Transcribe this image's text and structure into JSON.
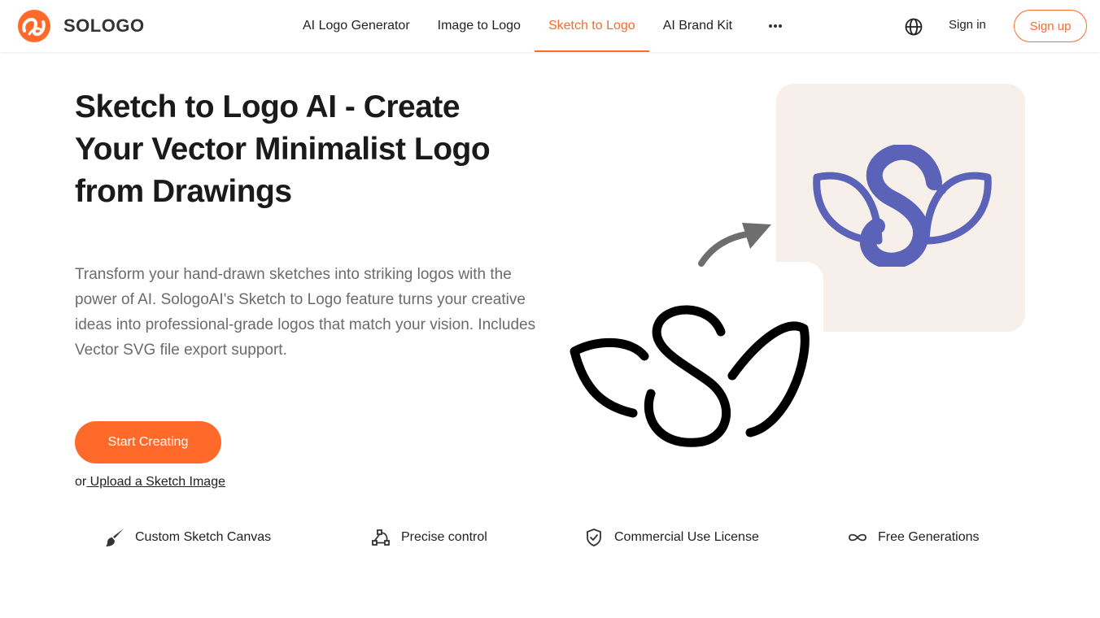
{
  "header": {
    "brand": "SOLOGO",
    "nav": [
      {
        "label": "AI Logo Generator",
        "active": false
      },
      {
        "label": "Image to Logo",
        "active": false
      },
      {
        "label": "Sketch to Logo",
        "active": true
      },
      {
        "label": "AI Brand Kit",
        "active": false
      }
    ],
    "more_icon": "more-dots-icon",
    "language_icon": "globe-icon",
    "signin_label": "Sign in",
    "signup_label": "Sign up"
  },
  "hero": {
    "title": "Sketch to Logo AI - Create Your Vector Minimalist Logo from Drawings",
    "description": "Transform your hand-drawn sketches into striking logos with the power of AI. SologoAI's Sketch to Logo feature turns your creative ideas into professional-grade logos that match your vision. Includes Vector SVG file export support.",
    "cta_label": "Start Creating",
    "upload_prefix": "or",
    "upload_link": " Upload a Sketch Image"
  },
  "features": [
    {
      "icon": "brush-icon",
      "label": "Custom Sketch Canvas"
    },
    {
      "icon": "nodes-icon",
      "label": "Precise control"
    },
    {
      "icon": "shield-check-icon",
      "label": "Commercial Use License"
    },
    {
      "icon": "infinity-icon",
      "label": "Free Generations"
    }
  ],
  "colors": {
    "accent": "#ff6a2a",
    "card_bg": "#f7efe9",
    "swan": "#5a63b8",
    "text_muted": "#6b6b6b"
  }
}
